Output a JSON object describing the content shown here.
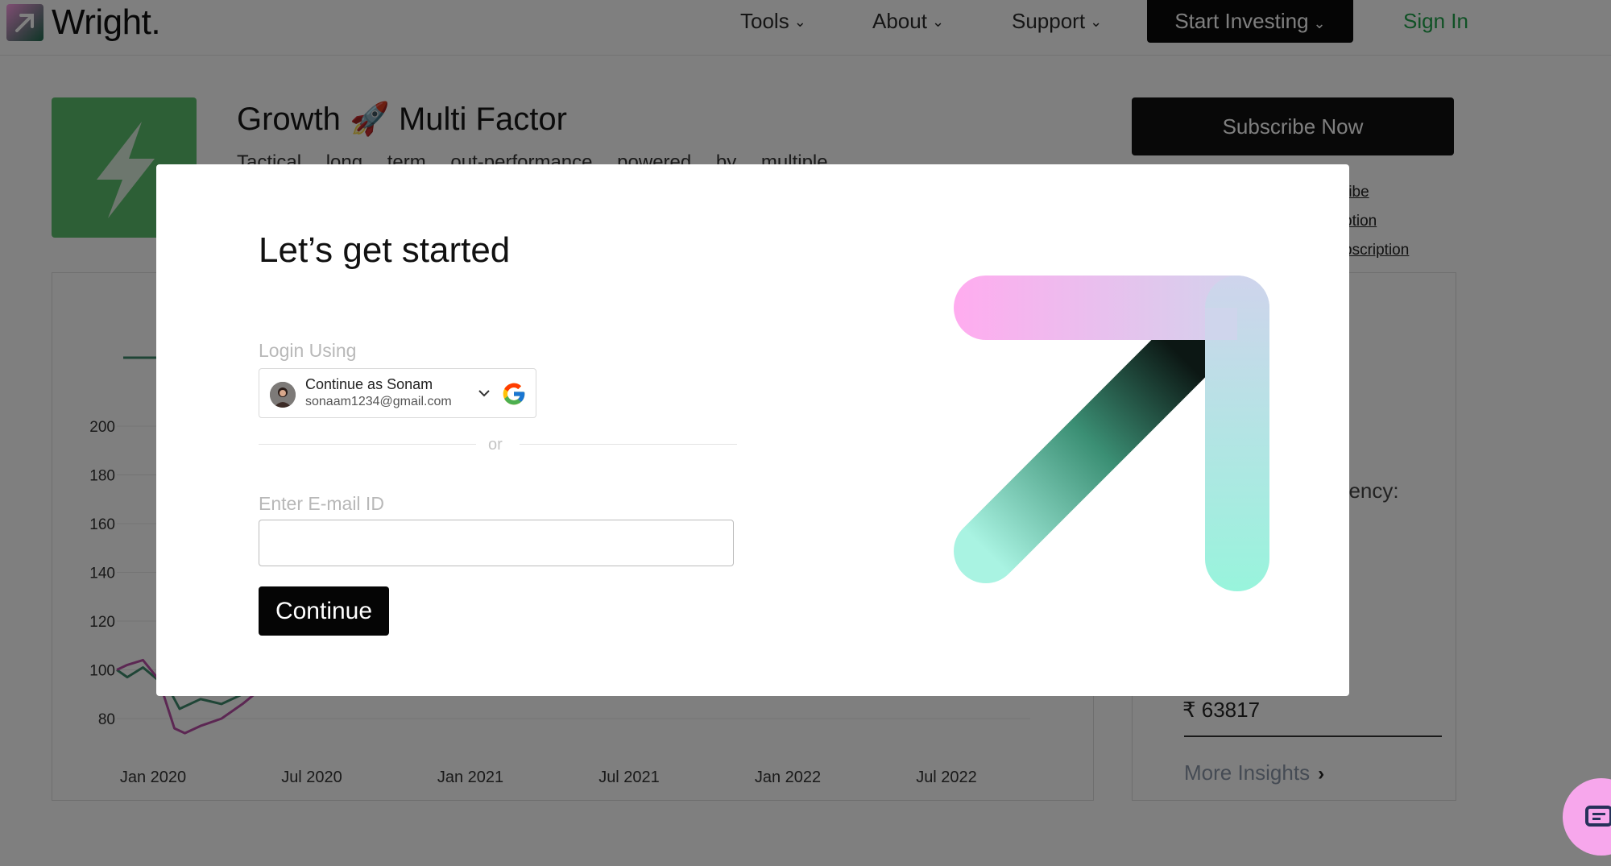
{
  "nav": {
    "brand": "Wright.",
    "items": [
      {
        "label": "Tools",
        "x": 919
      },
      {
        "label": "About",
        "x": 1083
      },
      {
        "label": "Support",
        "x": 1256
      }
    ],
    "start_investing": "Start Investing",
    "sign_in": "Sign In"
  },
  "strategy": {
    "title": "Growth 🚀 Multi Factor",
    "description": "Tactical long term out-performance powered by multiple",
    "subscribe": "Subscribe Now",
    "links": [
      "ribe",
      "ption",
      "bscription"
    ]
  },
  "chart_data": {
    "type": "line",
    "y_ticks": [
      80,
      100,
      120,
      140,
      160,
      180,
      200
    ],
    "x_ticks": [
      "Jan 2020",
      "Jul 2020",
      "Jan 2021",
      "Jul 2021",
      "Jan 2022",
      "Jul 2022"
    ],
    "ylim": [
      70,
      210
    ],
    "series": [
      {
        "color": "#3f8a6c",
        "points": [
          [
            0,
            100
          ],
          [
            0.1,
            97
          ],
          [
            0.25,
            101
          ],
          [
            0.5,
            92
          ],
          [
            0.6,
            84
          ],
          [
            0.8,
            88
          ],
          [
            1.0,
            86
          ],
          [
            1.2,
            90
          ],
          [
            1.4,
            97
          ]
        ]
      },
      {
        "color": "#b84ea6",
        "points": [
          [
            0,
            100
          ],
          [
            0.1,
            102
          ],
          [
            0.25,
            104
          ],
          [
            0.4,
            96
          ],
          [
            0.55,
            76
          ],
          [
            0.65,
            74
          ],
          [
            0.8,
            77
          ],
          [
            1.0,
            80
          ],
          [
            1.2,
            86
          ],
          [
            1.4,
            93
          ]
        ]
      }
    ]
  },
  "insight": {
    "frequency_label": "uency:",
    "amount": "₹ 63817",
    "more_insights": "More Insights",
    "more_arrow": "›"
  },
  "modal": {
    "title": "Let’s get started",
    "login_label": "Login Using",
    "google": {
      "name": "Continue as Sonam",
      "email": "sonaam1234@gmail.com"
    },
    "or_text": "or",
    "email_label": "Enter E-mail ID",
    "email_value": "",
    "continue_label": "Continue"
  },
  "colors": {
    "accent_green": "#1fa34a",
    "dark_button": "#0b0b0b",
    "pink": "#ffb1ee",
    "mint": "#9bf2dd"
  }
}
